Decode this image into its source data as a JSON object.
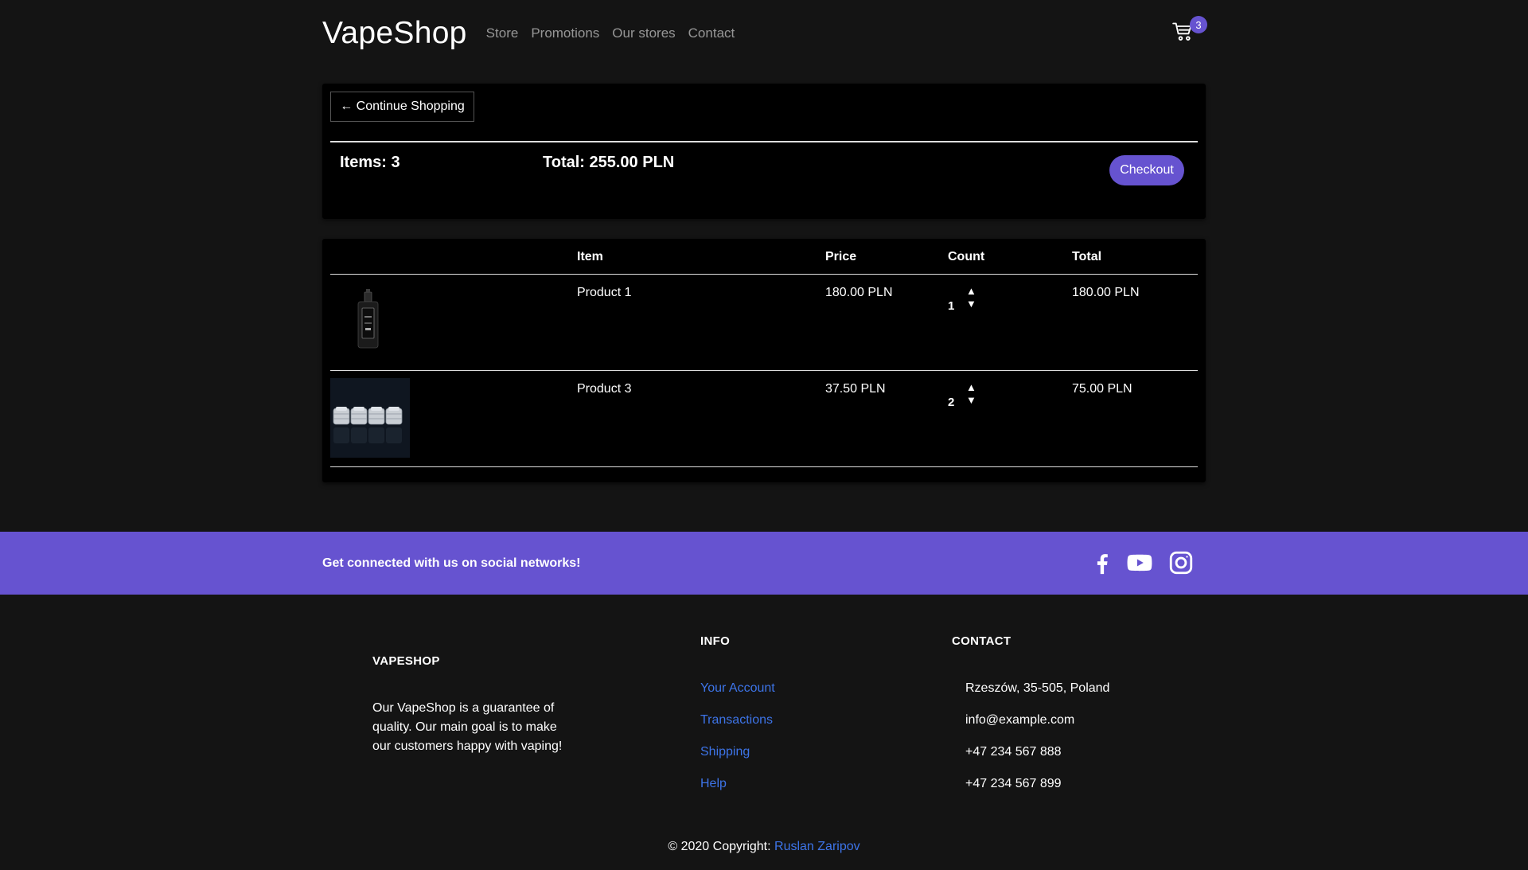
{
  "navbar": {
    "brand": "VapeShop",
    "links": [
      "Store",
      "Promotions",
      "Our stores",
      "Contact"
    ],
    "cart_count": "3"
  },
  "summary": {
    "continue_label": "← Continue Shopping",
    "items_label": "Items: 3",
    "total_label": "Total: 255.00 PLN",
    "checkout_label": "Checkout"
  },
  "table": {
    "headers": [
      "",
      "Item",
      "Price",
      "Count",
      "Total"
    ],
    "rows": [
      {
        "item": "Product 1",
        "price": "180.00 PLN",
        "count": "1",
        "total": "180.00 PLN",
        "image": "vape-mod-image"
      },
      {
        "item": "Product 3",
        "price": "37.50 PLN",
        "count": "2",
        "total": "75.00 PLN",
        "image": "drip-tips-image"
      }
    ],
    "arrow_up": "▲",
    "arrow_down": "▼"
  },
  "social": {
    "text": "Get connected with us on social networks!",
    "icons": [
      "facebook-icon",
      "youtube-icon",
      "instagram-icon"
    ]
  },
  "footer": {
    "brand_heading": "VAPESHOP",
    "brand_text": "Our VapeShop is a guarantee of quality. Our main goal is to make our customers happy with vaping!",
    "info_heading": "INFO",
    "info_links": [
      "Your Account",
      "Transactions",
      "Shipping",
      "Help"
    ],
    "contact_heading": "CONTACT",
    "contact_items": [
      "Rzeszów, 35-505, Poland",
      "info@example.com",
      "+47 234 567 888",
      "+47 234 567 899"
    ],
    "copyright_prefix": "© 2020 Copyright: ",
    "copyright_author": "Ruslan Zaripov"
  },
  "colors": {
    "accent": "#6653d0",
    "link": "#3d74e8",
    "background": "#141414",
    "card": "#000000"
  }
}
